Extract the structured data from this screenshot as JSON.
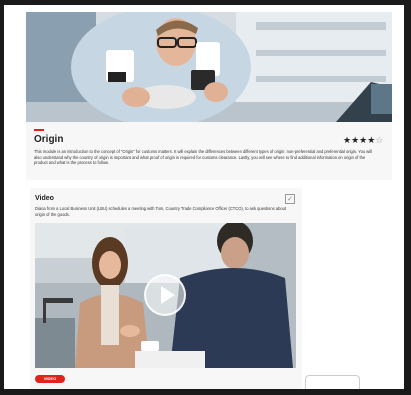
{
  "module": {
    "title": "Origin",
    "rating": {
      "filled": 4,
      "total": 5,
      "stars": "★★★★",
      "empty_stars": "☆"
    },
    "description": "This module is an introduction to the concept of \"Origin\" for customs matters. It will explain the differences between different types of origin: non-preferential and preferential origin. You will also understand why the country of origin is important and what proof of origin is required for customs clearance. Lastly, you will see where to find additional information on origin of the product and what is the process to follow.",
    "image": "engineer-with-safety-glasses-photo"
  },
  "video": {
    "title": "Video",
    "completed_checkmark": "✓",
    "description": "Diana from a Local Business Unit (LBU) schedules a meeting with Tom, Country Trade Compliance Officer (CTCO), to ask questions about origin of the goods.",
    "image": "meeting-office-photo",
    "badge": "VIDEO"
  },
  "colors": {
    "accent": "#e2231a",
    "card_bg": "#f7f7f7"
  }
}
